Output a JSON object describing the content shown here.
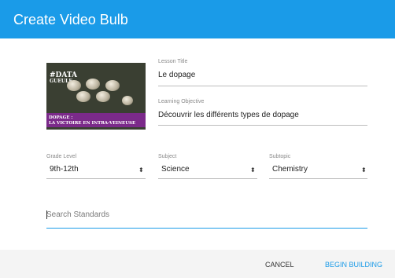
{
  "dialog": {
    "title": "Create Video Bulb"
  },
  "thumbnail": {
    "tag_line1": "#DATA",
    "tag_line2": "GUEULE",
    "caption_line1": "DOPAGE :",
    "caption_line2": "LA VICTOIRE EN INTRA-VEINEUSE",
    "caption_color": "#7b2a8a"
  },
  "lesson_title": {
    "label": "Lesson Title",
    "value": "Le dopage"
  },
  "learning_objective": {
    "label": "Learning Objective",
    "value": "Découvrir les différents types de dopage"
  },
  "grade_level": {
    "label": "Grade Level",
    "value": "9th-12th",
    "icon": "select-arrows-icon"
  },
  "subject": {
    "label": "Subject",
    "value": "Science",
    "icon": "select-arrows-icon"
  },
  "subtopic": {
    "label": "Subtopic",
    "value": "Chemistry",
    "icon": "select-arrows-icon"
  },
  "search": {
    "placeholder": "Search Standards",
    "value": ""
  },
  "footer": {
    "cancel_label": "CANCEL",
    "begin_label": "BEGIN BUILDING"
  },
  "colors": {
    "accent": "#1a9be8",
    "header_bg": "#1a9be8"
  },
  "select_arrow_glyph": "⬍"
}
